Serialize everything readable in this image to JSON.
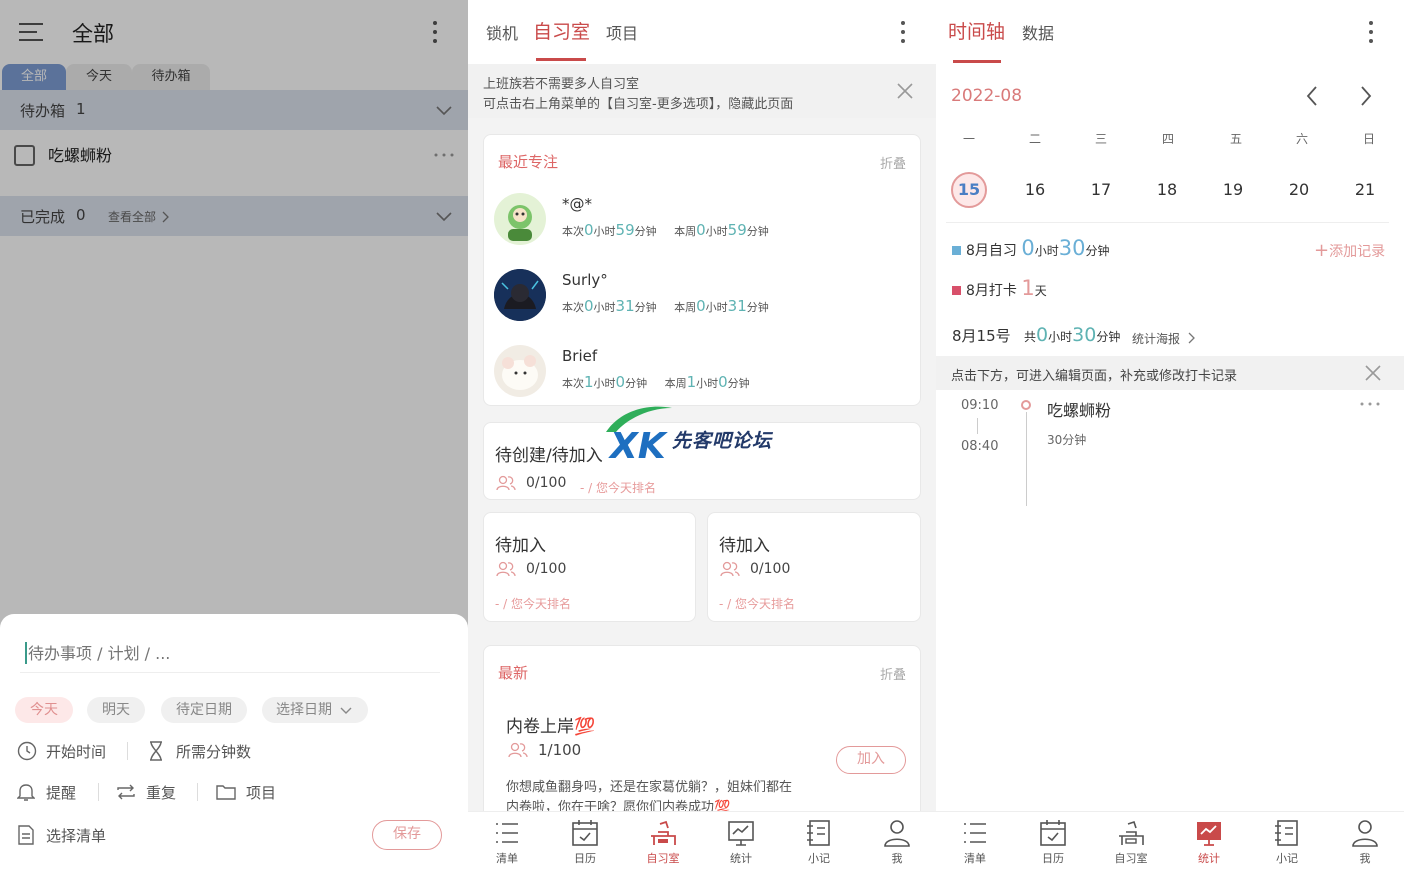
{
  "panel_list": {
    "title": "全部",
    "tabs": [
      "全部",
      "今天",
      "待办箱"
    ],
    "section_inbox": {
      "label": "待办箱",
      "count": "1"
    },
    "task": {
      "text": "吃螺蛳粉"
    },
    "section_done": {
      "label": "已完成",
      "count": "0",
      "link": "查看全部"
    },
    "input_placeholder": "待办事项 / 计划 / ...",
    "chips": [
      "今天",
      "明天",
      "待定日期",
      "选择日期"
    ],
    "options": {
      "start_time": "开始时间",
      "duration": "所需分钟数",
      "reminder": "提醒",
      "repeat": "重复",
      "project": "项目",
      "list": "选择清单"
    },
    "save_label": "保存"
  },
  "panel_study": {
    "tabs": [
      "锁机",
      "自习室",
      "项目"
    ],
    "active_tab": "自习室",
    "notice_line1": "上班族若不需要多人自习室",
    "notice_line2": "可点击右上角菜单的【自习室-更多选项】，隐藏此页面",
    "recent": {
      "title": "最近专注",
      "fold": "折叠",
      "members": [
        {
          "name": "*@*",
          "this_label": "本次",
          "this_h": "0",
          "this_m": "59",
          "week_label": "本周",
          "week_h": "0",
          "week_m": "59"
        },
        {
          "name": "Surly°",
          "this_label": "本次",
          "this_h": "0",
          "this_m": "31",
          "week_label": "本周",
          "week_h": "0",
          "week_m": "31"
        },
        {
          "name": "Brief",
          "this_label": "本次",
          "this_h": "1",
          "this_m": "0",
          "week_label": "本周",
          "week_h": "1",
          "week_m": "0"
        }
      ],
      "hour_unit": "小时",
      "minute_unit": "分钟"
    },
    "room1": {
      "title": "待创建/待加入",
      "count": "0/100",
      "rank": "- / 您今天排名"
    },
    "room2": {
      "title": "待加入",
      "count": "0/100",
      "rank": "- / 您今天排名"
    },
    "room3": {
      "title": "待加入",
      "count": "0/100",
      "rank": "- / 您今天排名"
    },
    "latest": {
      "title": "最新",
      "fold": "折叠",
      "room_name": "内卷上岸💯",
      "count": "1/100",
      "join": "加入",
      "desc1": "你想咸鱼翻身吗，还是在家葛优躺？，姐妹们都在",
      "desc2": "内卷啦，你在干啥？愿你们内卷成功💯"
    },
    "watermark": "先客吧论坛"
  },
  "nav": {
    "items": [
      "清单",
      "日历",
      "自习室",
      "统计",
      "小记",
      "我"
    ]
  },
  "panel_timeline": {
    "tabs": [
      "时间轴",
      "数据"
    ],
    "month": "2022-08",
    "weekdays": [
      "一",
      "二",
      "三",
      "四",
      "五",
      "六",
      "日"
    ],
    "days": [
      "15",
      "16",
      "17",
      "18",
      "19",
      "20",
      "21"
    ],
    "selected_day": "15",
    "study_label": "8月自习",
    "study_h": "0",
    "study_m": "30",
    "hour_unit": "小时",
    "minute_unit": "分钟",
    "add_record": "添加记录",
    "checkin_label": "8月打卡",
    "checkin_count": "1",
    "day_unit": "天",
    "date_label": "8月15号",
    "total_label": "共",
    "total_h": "0",
    "total_m": "30",
    "poster": "统计海报",
    "tip": "点击下方，可进入编辑页面，补充或修改打卡记录",
    "entry": {
      "start": "09:10",
      "end": "08:40",
      "title": "吃螺蛳粉",
      "duration": "30分钟"
    }
  },
  "colors": {
    "accent": "#c94a4a",
    "teal": "#5fb3b3",
    "pink": "#e39a9a",
    "blue_tab": "#7f9fd6"
  }
}
